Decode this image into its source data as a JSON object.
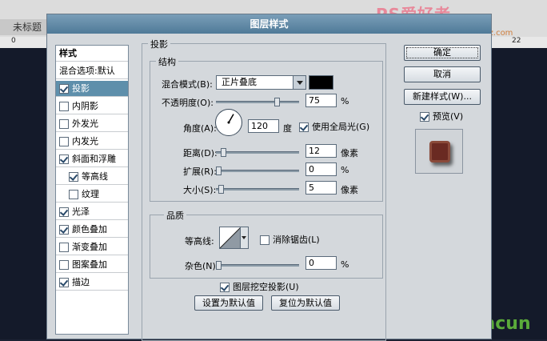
{
  "background": {
    "doc_tab": "未标题",
    "ruler_left": "0",
    "ruler_right": "22",
    "watermark_top": "PS爱好者",
    "watermark_url": "www.PSahz.com",
    "watermark_bottom": "shancun"
  },
  "dialog": {
    "title": "图层样式",
    "styles_header": "样式",
    "style_items": [
      {
        "label": "混合选项:默认",
        "check": null,
        "selected": false
      },
      {
        "label": "投影",
        "check": true,
        "selected": true
      },
      {
        "label": "内阴影",
        "check": false,
        "selected": false
      },
      {
        "label": "外发光",
        "check": false,
        "selected": false
      },
      {
        "label": "内发光",
        "check": false,
        "selected": false
      },
      {
        "label": "斜面和浮雕",
        "check": true,
        "selected": false
      },
      {
        "label": "等高线",
        "check": true,
        "selected": false,
        "indent": true
      },
      {
        "label": "纹理",
        "check": false,
        "selected": false,
        "indent": true
      },
      {
        "label": "光泽",
        "check": true,
        "selected": false
      },
      {
        "label": "颜色叠加",
        "check": true,
        "selected": false
      },
      {
        "label": "渐变叠加",
        "check": false,
        "selected": false
      },
      {
        "label": "图案叠加",
        "check": false,
        "selected": false
      },
      {
        "label": "描边",
        "check": true,
        "selected": false
      }
    ],
    "section_title": "投影",
    "structure": {
      "title": "结构",
      "blend_mode_label": "混合模式(B):",
      "blend_mode_value": "正片叠底",
      "blend_color": "#000000",
      "opacity_label": "不透明度(O):",
      "opacity_value": "75",
      "opacity_pct": 75,
      "opacity_unit": "%",
      "angle_label": "角度(A):",
      "angle_value": "120",
      "angle_unit": "度",
      "global_light_label": "使用全局光(G)",
      "global_light": true,
      "distance_label": "距离(D):",
      "distance_value": "12",
      "distance_pct": 6,
      "distance_unit": "像素",
      "spread_label": "扩展(R):",
      "spread_value": "0",
      "spread_pct": 0,
      "spread_unit": "%",
      "size_label": "大小(S):",
      "size_value": "5",
      "size_pct": 3,
      "size_unit": "像素"
    },
    "quality": {
      "title": "品质",
      "contour_label": "等高线:",
      "antialias_label": "消除锯齿(L)",
      "antialias": false,
      "noise_label": "杂色(N):",
      "noise_value": "0",
      "noise_pct": 0,
      "noise_unit": "%"
    },
    "knockout_label": "图层挖空投影(U)",
    "knockout": true,
    "make_default_label": "设置为默认值",
    "reset_default_label": "复位为默认值",
    "buttons": {
      "ok": "确定",
      "cancel": "取消",
      "new_style": "新建样式(W)...",
      "preview_label": "预览(V)",
      "preview": true
    }
  }
}
